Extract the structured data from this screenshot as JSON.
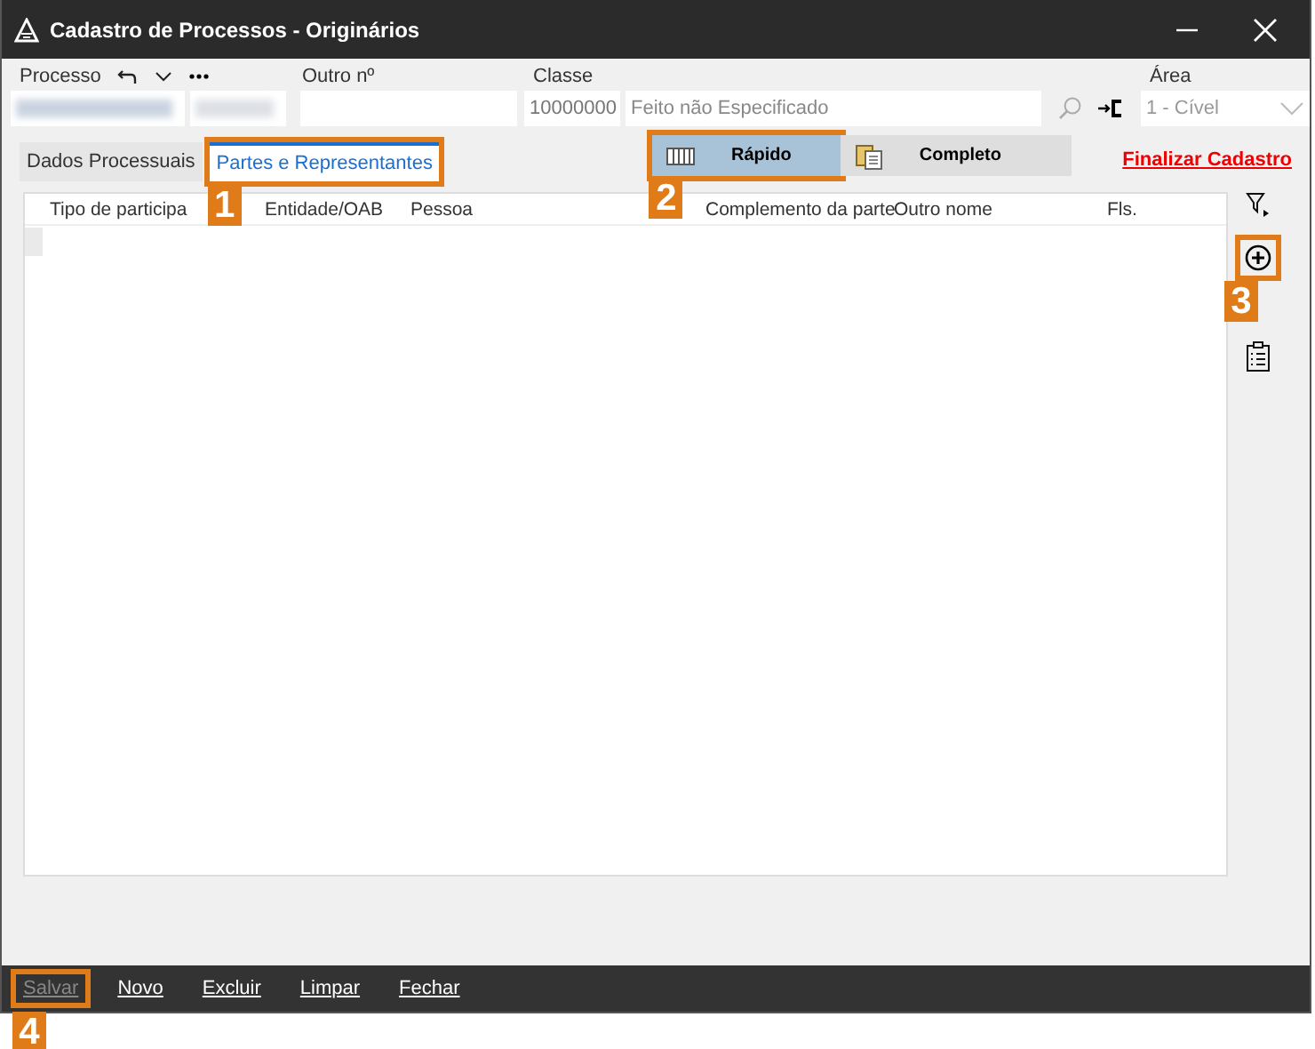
{
  "window": {
    "title": "Cadastro de Processos - Originários"
  },
  "header": {
    "processo_label": "Processo",
    "outro_label": "Outro nº",
    "classe_label": "Classe",
    "classe_code": "10000000",
    "classe_name": "Feito não Especificado",
    "area_label": "Área",
    "area_value": "1 - Cível"
  },
  "tabs": [
    {
      "label": "Dados Processuais",
      "selected": false
    },
    {
      "label": "Partes e Representantes",
      "selected": true
    }
  ],
  "modes": [
    {
      "label": "Rápido",
      "selected": true
    },
    {
      "label": "Completo",
      "selected": false
    }
  ],
  "finalize_link": "Finalizar Cadastro",
  "table": {
    "columns": [
      "Tipo de participa",
      "Entidade/OAB",
      "Pessoa",
      "Complemento da parte",
      "Outro nome",
      "Fls."
    ]
  },
  "footer_buttons": [
    {
      "label": "Salvar",
      "disabled": true
    },
    {
      "label": "Novo",
      "disabled": false
    },
    {
      "label": "Excluir",
      "disabled": false
    },
    {
      "label": "Limpar",
      "disabled": false
    },
    {
      "label": "Fechar",
      "disabled": false
    }
  ],
  "callouts": [
    "1",
    "2",
    "3",
    "4"
  ]
}
